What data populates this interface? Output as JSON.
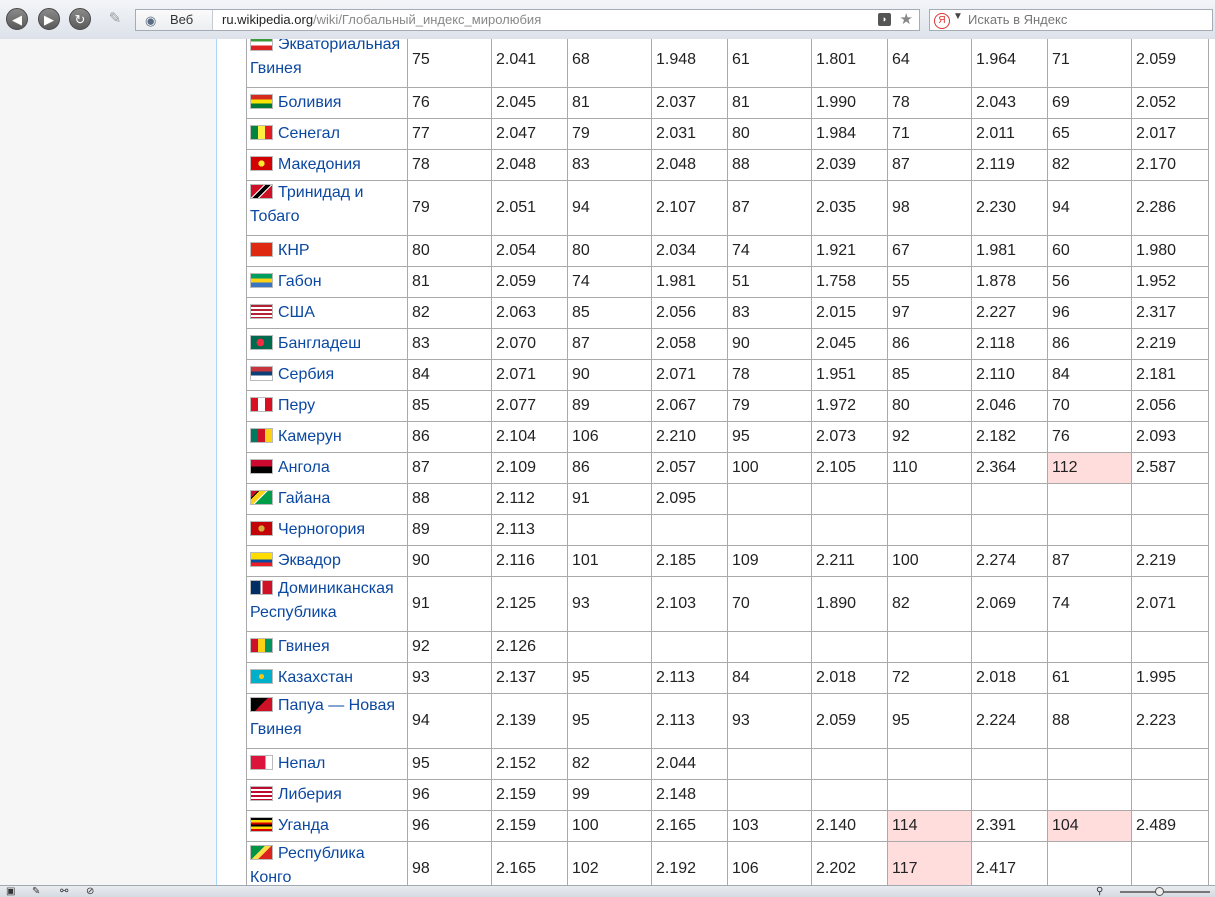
{
  "browser": {
    "search_mode_label": "Веб",
    "url_host": "ru.wikipedia.org",
    "url_path": "/wiki/Глобальный_индекс_миролюбия",
    "search_placeholder": "Искать в Яндекс",
    "yandex_logo_letter": "Я"
  },
  "table": {
    "rows": [
      {
        "country": "Экваториальная Гвинея",
        "flag": "equatorial-guinea",
        "cells": [
          "75",
          "2.041",
          "68",
          "1.948",
          "61",
          "1.801",
          "64",
          "1.964",
          "71",
          "2.059"
        ],
        "hl": []
      },
      {
        "country": "Боливия",
        "flag": "bolivia",
        "cells": [
          "76",
          "2.045",
          "81",
          "2.037",
          "81",
          "1.990",
          "78",
          "2.043",
          "69",
          "2.052"
        ],
        "hl": []
      },
      {
        "country": "Сенегал",
        "flag": "senegal",
        "cells": [
          "77",
          "2.047",
          "79",
          "2.031",
          "80",
          "1.984",
          "71",
          "2.011",
          "65",
          "2.017"
        ],
        "hl": []
      },
      {
        "country": "Македония",
        "flag": "macedonia",
        "cells": [
          "78",
          "2.048",
          "83",
          "2.048",
          "88",
          "2.039",
          "87",
          "2.119",
          "82",
          "2.170"
        ],
        "hl": []
      },
      {
        "country": "Тринидад и Тобаго",
        "flag": "trinidad",
        "cells": [
          "79",
          "2.051",
          "94",
          "2.107",
          "87",
          "2.035",
          "98",
          "2.230",
          "94",
          "2.286"
        ],
        "hl": []
      },
      {
        "country": "КНР",
        "flag": "china",
        "cells": [
          "80",
          "2.054",
          "80",
          "2.034",
          "74",
          "1.921",
          "67",
          "1.981",
          "60",
          "1.980"
        ],
        "hl": []
      },
      {
        "country": "Габон",
        "flag": "gabon",
        "cells": [
          "81",
          "2.059",
          "74",
          "1.981",
          "51",
          "1.758",
          "55",
          "1.878",
          "56",
          "1.952"
        ],
        "hl": []
      },
      {
        "country": "США",
        "flag": "usa",
        "cells": [
          "82",
          "2.063",
          "85",
          "2.056",
          "83",
          "2.015",
          "97",
          "2.227",
          "96",
          "2.317"
        ],
        "hl": []
      },
      {
        "country": "Бангладеш",
        "flag": "bangladesh",
        "cells": [
          "83",
          "2.070",
          "87",
          "2.058",
          "90",
          "2.045",
          "86",
          "2.118",
          "86",
          "2.219"
        ],
        "hl": []
      },
      {
        "country": "Сербия",
        "flag": "serbia",
        "cells": [
          "84",
          "2.071",
          "90",
          "2.071",
          "78",
          "1.951",
          "85",
          "2.110",
          "84",
          "2.181"
        ],
        "hl": []
      },
      {
        "country": "Перу",
        "flag": "peru",
        "cells": [
          "85",
          "2.077",
          "89",
          "2.067",
          "79",
          "1.972",
          "80",
          "2.046",
          "70",
          "2.056"
        ],
        "hl": []
      },
      {
        "country": "Камерун",
        "flag": "cameroon",
        "cells": [
          "86",
          "2.104",
          "106",
          "2.210",
          "95",
          "2.073",
          "92",
          "2.182",
          "76",
          "2.093"
        ],
        "hl": []
      },
      {
        "country": "Ангола",
        "flag": "angola",
        "cells": [
          "87",
          "2.109",
          "86",
          "2.057",
          "100",
          "2.105",
          "110",
          "2.364",
          "112",
          "2.587"
        ],
        "hl": [
          8
        ]
      },
      {
        "country": "Гайана",
        "flag": "guyana",
        "cells": [
          "88",
          "2.112",
          "91",
          "2.095",
          "",
          "",
          "",
          "",
          "",
          ""
        ],
        "hl": []
      },
      {
        "country": "Черногория",
        "flag": "montenegro",
        "cells": [
          "89",
          "2.113",
          "",
          "",
          "",
          "",
          "",
          "",
          "",
          ""
        ],
        "hl": []
      },
      {
        "country": "Эквадор",
        "flag": "ecuador",
        "cells": [
          "90",
          "2.116",
          "101",
          "2.185",
          "109",
          "2.211",
          "100",
          "2.274",
          "87",
          "2.219"
        ],
        "hl": []
      },
      {
        "country": "Доминиканская Республика",
        "flag": "dominican",
        "cells": [
          "91",
          "2.125",
          "93",
          "2.103",
          "70",
          "1.890",
          "82",
          "2.069",
          "74",
          "2.071"
        ],
        "hl": []
      },
      {
        "country": "Гвинея",
        "flag": "guinea",
        "cells": [
          "92",
          "2.126",
          "",
          "",
          "",
          "",
          "",
          "",
          "",
          ""
        ],
        "hl": []
      },
      {
        "country": "Казахстан",
        "flag": "kazakhstan",
        "cells": [
          "93",
          "2.137",
          "95",
          "2.113",
          "84",
          "2.018",
          "72",
          "2.018",
          "61",
          "1.995"
        ],
        "hl": []
      },
      {
        "country": "Папуа — Новая Гвинея",
        "flag": "png",
        "cells": [
          "94",
          "2.139",
          "95",
          "2.113",
          "93",
          "2.059",
          "95",
          "2.224",
          "88",
          "2.223"
        ],
        "hl": []
      },
      {
        "country": "Непал",
        "flag": "nepal",
        "cells": [
          "95",
          "2.152",
          "82",
          "2.044",
          "",
          "",
          "",
          "",
          "",
          ""
        ],
        "hl": []
      },
      {
        "country": "Либерия",
        "flag": "liberia",
        "cells": [
          "96",
          "2.159",
          "99",
          "2.148",
          "",
          "",
          "",
          "",
          "",
          ""
        ],
        "hl": []
      },
      {
        "country": "Уганда",
        "flag": "uganda",
        "cells": [
          "96",
          "2.159",
          "100",
          "2.165",
          "103",
          "2.140",
          "114",
          "2.391",
          "104",
          "2.489"
        ],
        "hl": [
          6,
          8
        ]
      },
      {
        "country": "Республика Конго",
        "flag": "congo",
        "cells": [
          "98",
          "2.165",
          "102",
          "2.192",
          "106",
          "2.202",
          "117",
          "2.417",
          "",
          ""
        ],
        "hl": [
          6
        ]
      }
    ]
  }
}
